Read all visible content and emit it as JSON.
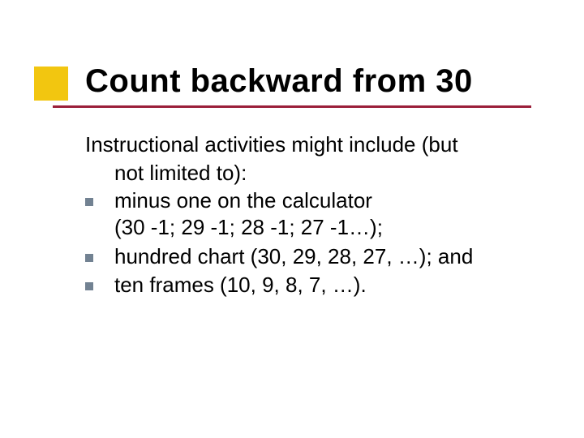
{
  "title": "Count backward from 30",
  "intro_line1": "Instructional activities might include (but",
  "intro_line2": "not limited to):",
  "bullets": [
    {
      "line1": "minus one on the calculator",
      "line2": "(30 -1; 29 -1; 28 -1; 27 -1…);"
    },
    {
      "line1": "hundred chart (30, 29, 28, 27, …); and",
      "line2": ""
    },
    {
      "line1": "ten frames (10, 9, 8, 7, …).",
      "line2": ""
    }
  ],
  "colors": {
    "accent_square": "#f2c610",
    "underline": "#9b1f3a",
    "bullet": "#728292"
  }
}
